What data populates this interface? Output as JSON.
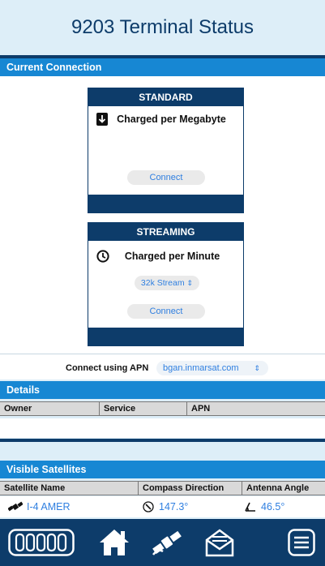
{
  "header": {
    "title": "9203 Terminal Status"
  },
  "current_connection": {
    "title": "Current Connection",
    "standard": {
      "title": "STANDARD",
      "label": "Charged per Megabyte",
      "connect_label": "Connect"
    },
    "streaming": {
      "title": "STREAMING",
      "label": "Charged per Minute",
      "stream_option": "32k Stream ⭘",
      "stream_selected": "32k Stream",
      "connect_label": "Connect"
    },
    "apn": {
      "label": "Connect using APN",
      "value": "bgan.inmarsat.com"
    }
  },
  "details": {
    "title": "Details",
    "columns": [
      "Owner",
      "Service",
      "APN"
    ]
  },
  "visible_satellites": {
    "title": "Visible Satellites",
    "columns": [
      "Satellite Name",
      "Compass Direction",
      "Antenna Angle"
    ],
    "rows": [
      {
        "name": "I-4 AMER",
        "compass": "147.3°",
        "angle": "46.5°"
      }
    ]
  },
  "tabbar": {
    "items": [
      "signal-bars-icon",
      "home-icon",
      "satellite-icon",
      "mail-icon",
      "menu-icon"
    ]
  },
  "colors": {
    "navy": "#0d3c6a",
    "accent_blue": "#1787d3",
    "link_blue": "#2f7fe0",
    "background": "#ddeef8"
  }
}
